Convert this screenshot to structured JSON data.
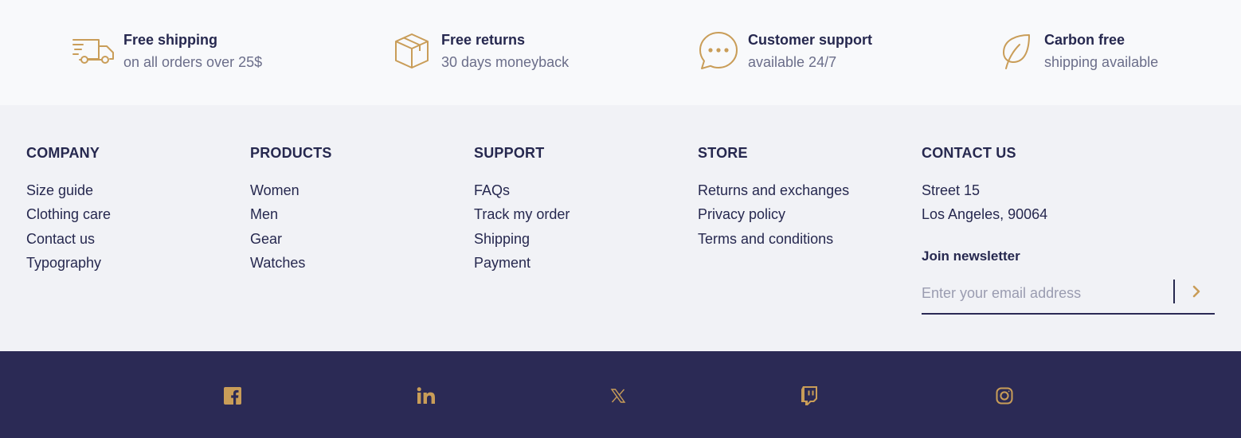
{
  "colors": {
    "accent": "#c99d58",
    "navy": "#26284f",
    "footer_dark": "#2b2a55",
    "muted": "#6b6e8a",
    "bg_top": "#f8f9fb",
    "bg_links": "#f1f2f6"
  },
  "features": [
    {
      "icon": "truck-icon",
      "title": "Free shipping",
      "subtitle": "on all orders over 25$"
    },
    {
      "icon": "box-icon",
      "title": "Free returns",
      "subtitle": "30 days moneyback"
    },
    {
      "icon": "chat-bubble-icon",
      "title": "Customer support",
      "subtitle": "available 24/7"
    },
    {
      "icon": "leaf-icon",
      "title": "Carbon free",
      "subtitle": "shipping available"
    }
  ],
  "columns": [
    {
      "heading": "COMPANY",
      "items": [
        "Size guide",
        "Clothing care",
        "Contact us",
        "Typography"
      ]
    },
    {
      "heading": "PRODUCTS",
      "items": [
        "Women",
        "Men",
        "Gear",
        "Watches"
      ]
    },
    {
      "heading": "SUPPORT",
      "items": [
        "FAQs",
        "Track my order",
        "Shipping",
        "Payment"
      ]
    },
    {
      "heading": "STORE",
      "items": [
        "Returns and exchanges",
        "Privacy policy",
        "Terms and conditions"
      ]
    }
  ],
  "contact": {
    "heading": "CONTACT US",
    "address_line1": "Street 15",
    "address_line2": "Los Angeles, 90064"
  },
  "newsletter": {
    "title": "Join newsletter",
    "placeholder": "Enter your email address",
    "value": ""
  },
  "social": [
    "facebook-icon",
    "linkedin-icon",
    "x-icon",
    "twitch-icon",
    "instagram-icon"
  ]
}
